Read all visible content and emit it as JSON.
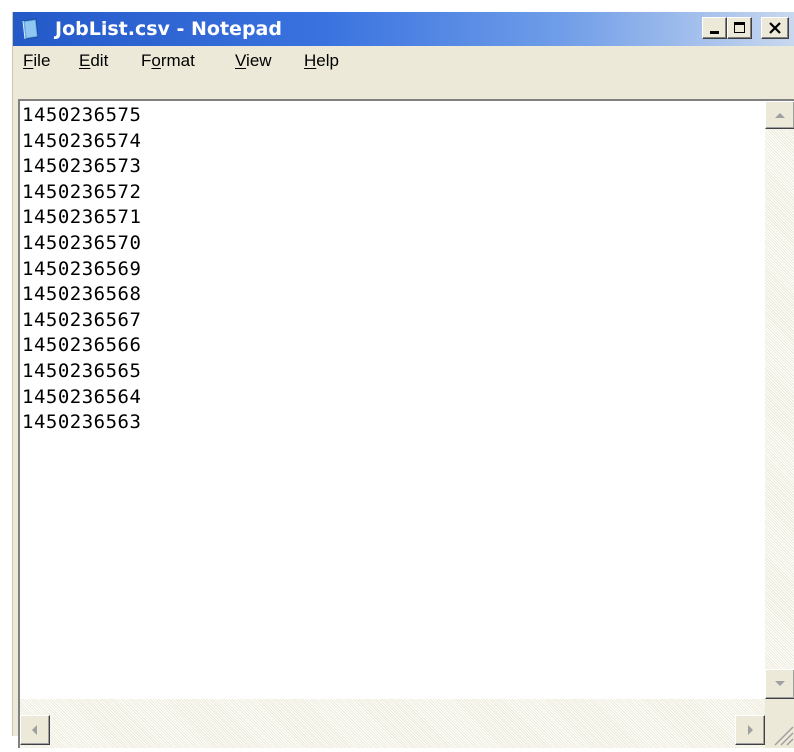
{
  "window": {
    "title": "JobList.csv - Notepad",
    "accent": "#2459c8"
  },
  "menu": {
    "items": [
      {
        "label": "File",
        "mnemonic": "F",
        "rest": "ile"
      },
      {
        "label": "Edit",
        "mnemonic": "E",
        "rest": "dit"
      },
      {
        "label": "Format",
        "pre": "F",
        "mnemonic": "o",
        "rest": "rmat"
      },
      {
        "label": "View",
        "mnemonic": "V",
        "rest": "iew"
      },
      {
        "label": "Help",
        "mnemonic": "H",
        "rest": "elp"
      }
    ]
  },
  "editor": {
    "lines": [
      "1450236575",
      "1450236574",
      "1450236573",
      "1450236572",
      "1450236571",
      "1450236570",
      "1450236569",
      "1450236568",
      "1450236567",
      "1450236566",
      "1450236565",
      "1450236564",
      "1450236563"
    ]
  },
  "icons": {
    "app": "notepad-icon",
    "minimize": "minimize-icon",
    "maximize": "maximize-icon",
    "close": "close-icon",
    "scroll_up": "arrow-up-icon",
    "scroll_down": "arrow-down-icon",
    "scroll_left": "arrow-left-icon",
    "scroll_right": "arrow-right-icon"
  }
}
